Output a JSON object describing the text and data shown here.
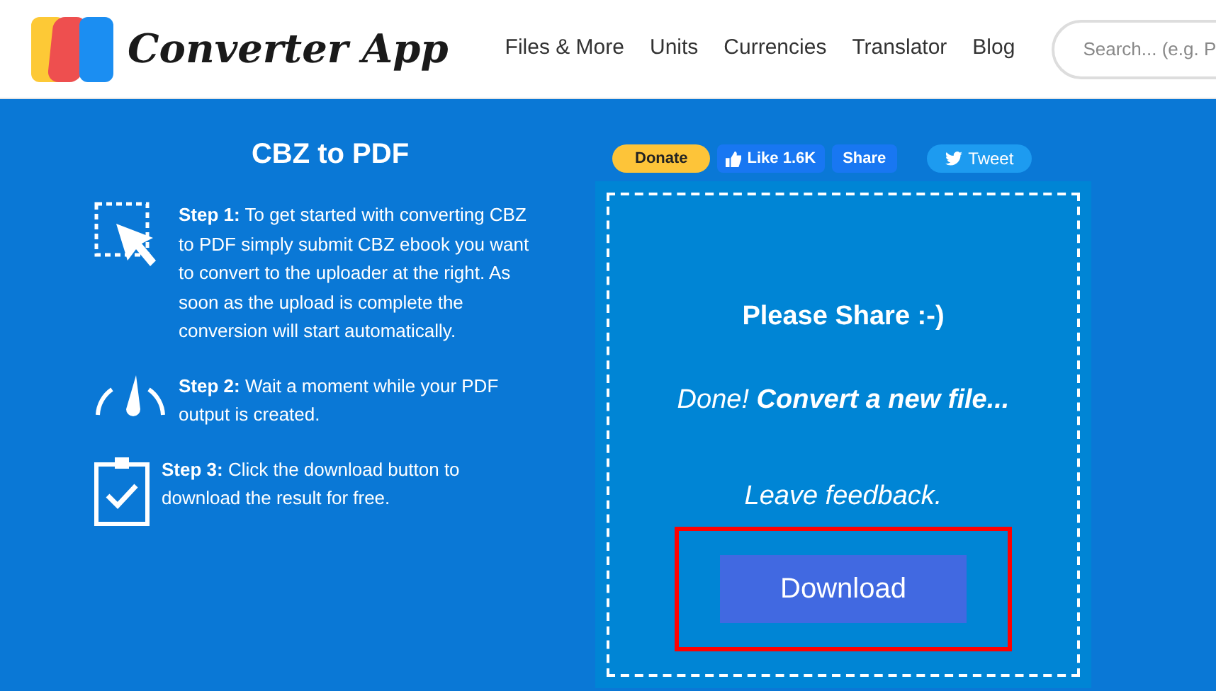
{
  "header": {
    "logo_text": "Converter App",
    "nav": [
      "Files & More",
      "Units",
      "Currencies",
      "Translator",
      "Blog"
    ],
    "search": {
      "placeholder": "Search... (e.g. P"
    }
  },
  "title": "CBZ to PDF",
  "steps": [
    {
      "kind": "cursor",
      "text": "**Step 1:** To get started with converting CBZ to PDF simply submit CBZ ebook you want to convert to the uploader at the right. As soon as the upload is complete the conversion will start automatically."
    },
    {
      "kind": "gauge",
      "text": "**Step 2:** Wait a moment while your PDF output is created."
    },
    {
      "kind": "clipboard",
      "text": "**Step 3:** Click the download button to download the result for free."
    }
  ],
  "social": {
    "donate": "Donate",
    "like": "Like 1.6K",
    "share": "Share",
    "tweet": "Tweet"
  },
  "result": {
    "heading": "Please Share :-)",
    "done": "Done! **Convert a new file...**",
    "feedback": "Leave feedback.",
    "download": "Download",
    "highlighted": true
  }
}
